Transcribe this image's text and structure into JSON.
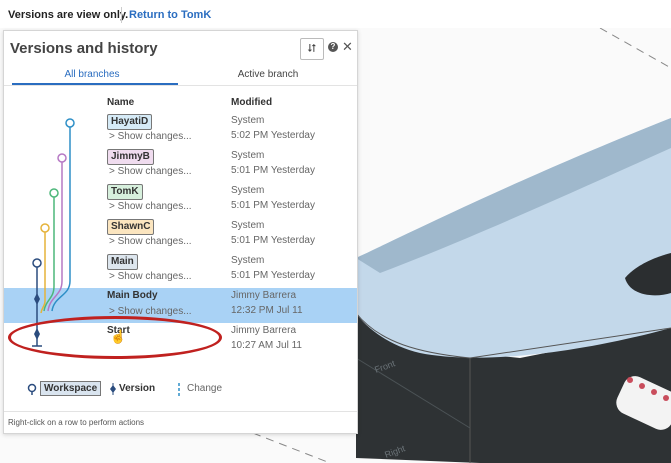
{
  "topbar": {
    "message": "Versions are view only.",
    "link": "Return to TomK"
  },
  "panel": {
    "title": "Versions and history",
    "tabs": [
      {
        "label": "All branches"
      },
      {
        "label": "Active branch"
      }
    ],
    "columns": {
      "name": "Name",
      "modified": "Modified"
    },
    "rows": [
      {
        "name": "HayatiD",
        "show": "> Show changes...",
        "who": "System",
        "when": "5:02 PM Yesterday",
        "tag_color": "#d6ebf7"
      },
      {
        "name": "JimmyB",
        "show": "> Show changes...",
        "who": "System",
        "when": "5:01 PM Yesterday",
        "tag_color": "#f0dcef"
      },
      {
        "name": "TomK",
        "show": "> Show changes...",
        "who": "System",
        "when": "5:01 PM Yesterday",
        "tag_color": "#d7f0dd"
      },
      {
        "name": "ShawnC",
        "show": "> Show changes...",
        "who": "System",
        "when": "5:01 PM Yesterday",
        "tag_color": "#fbe5bf"
      },
      {
        "name": "Main",
        "show": "> Show changes...",
        "who": "System",
        "when": "5:01 PM Yesterday",
        "tag_color": "#dde6ee"
      },
      {
        "name": "Main Body",
        "show": "> Show changes...",
        "who": "Jimmy Barrera",
        "when": "12:32 PM Jul 11"
      },
      {
        "name": "Start",
        "who": "Jimmy Barrera",
        "when": "10:27 AM Jul 11"
      }
    ],
    "legend": {
      "workspace": "Workspace",
      "version": "Version",
      "change": "Change"
    },
    "footer": "Right-click on a row to perform actions"
  },
  "colors": {
    "accent": "#2a6dc0",
    "selected_row": "#a9d2f5",
    "callout": "#c0211f",
    "branch_blue": "#2e8fc7",
    "branch_purple": "#b678c4",
    "branch_green": "#4db77a",
    "branch_yellow": "#e5b33a",
    "branch_main": "#2b4c7e"
  },
  "viewport": {
    "labels": {
      "front_1": "Front",
      "front_2": "Right"
    }
  }
}
